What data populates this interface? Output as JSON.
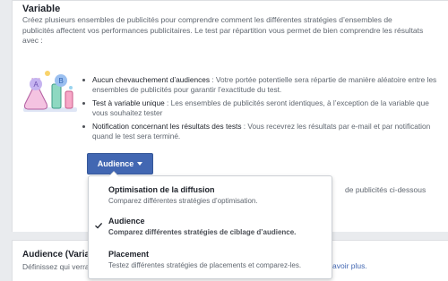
{
  "section": {
    "title": "Variable",
    "intro": "Créez plusieurs ensembles de publicités pour comprendre comment les différentes stratégies d’ensembles de publicités affectent vos performances publicitaires. Le test par répartition vous permet de bien comprendre les résultats avec :",
    "bullets": [
      {
        "title": "Aucun chevauchement d’audiences",
        "text": " : Votre portée potentielle sera répartie de manière aléatoire entre les ensembles de publicités pour garantir l’exactitude du test."
      },
      {
        "title": "Test à variable unique",
        "text": " : Les ensembles de publicités seront identiques, à l’exception de la variable que vous souhaitez tester"
      },
      {
        "title": "Notification concernant les résultats des tests",
        "text": " : Vous recevrez les résultats par e-mail et par notification quand le test sera terminé."
      }
    ],
    "audience_button_label": "Audience",
    "behind_text": "de publicités ci-dessous"
  },
  "dropdown": {
    "options": [
      {
        "title": "Optimisation de la diffusion",
        "desc": "Comparez différentes stratégies d’optimisation.",
        "selected": false
      },
      {
        "title": "Audience",
        "desc": "Comparez différentes stratégies de ciblage d’audience.",
        "selected": true
      },
      {
        "title": "Placement",
        "desc": "Testez différentes stratégies de placements et comparez-les.",
        "selected": false
      }
    ]
  },
  "section2": {
    "title": "Audience (Varia",
    "subtitle": "Définissez qui verra",
    "learn_more": "avoir plus."
  },
  "colors": {
    "accent": "#4267b2",
    "page_bg": "#e9ebee"
  },
  "icons": {
    "illustration": "lab-flasks-illustration",
    "caret": "caret-down-icon",
    "check": "checkmark-icon"
  }
}
